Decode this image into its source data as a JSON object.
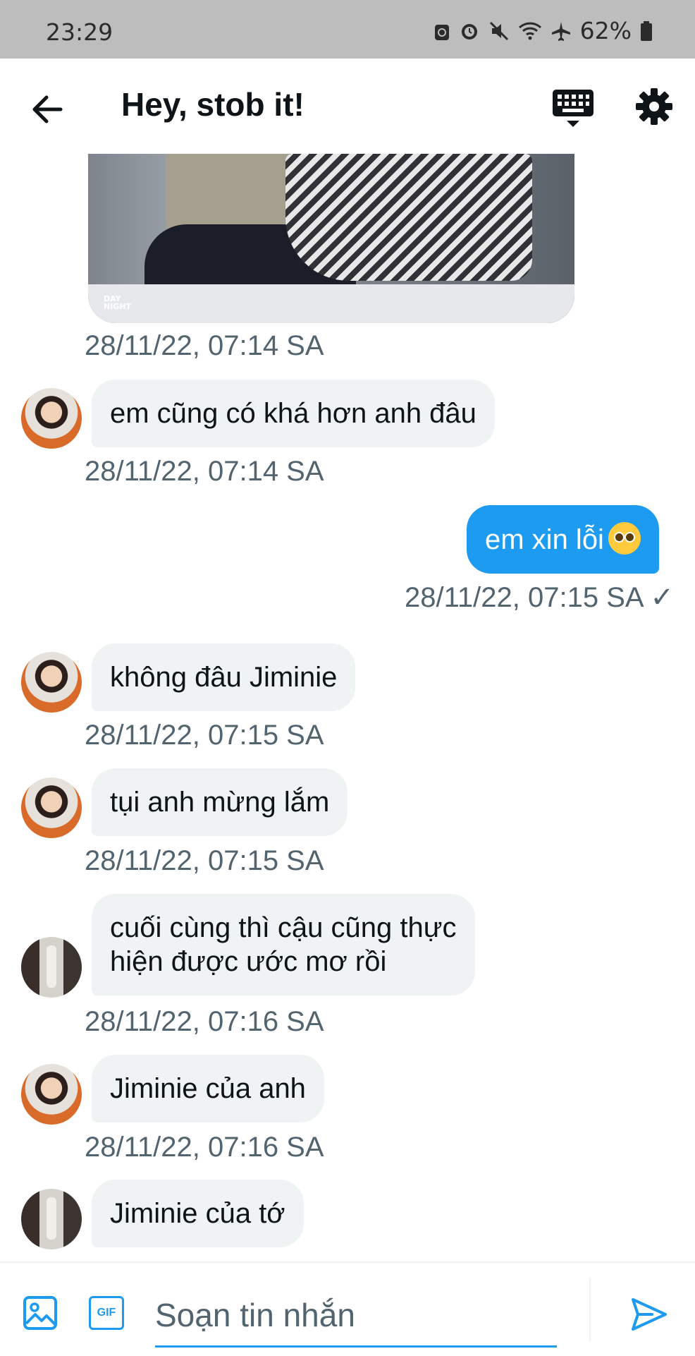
{
  "status_bar": {
    "time": "23:29",
    "battery": "62%"
  },
  "header": {
    "title": "Hey, stob it!"
  },
  "photo": {
    "logo_line1": "DAY",
    "logo_line2": "NIGHT"
  },
  "messages": [
    {
      "timestamp": "28/11/22, 07:14 SA"
    },
    {
      "text": "em cũng có khá hơn anh đâu",
      "timestamp": "28/11/22, 07:14 SA"
    },
    {
      "text": "em xin lỗi",
      "timestamp": "28/11/22, 07:15 SA ✓"
    },
    {
      "text": "không đâu Jiminie",
      "timestamp": "28/11/22, 07:15 SA"
    },
    {
      "text": "tụi anh mừng lắm",
      "timestamp": "28/11/22, 07:15 SA"
    },
    {
      "text_line1": "cuối cùng thì cậu cũng thực",
      "text_line2": "hiện được ước mơ rồi",
      "timestamp": "28/11/22, 07:16 SA"
    },
    {
      "text": "Jiminie của anh",
      "timestamp": "28/11/22, 07:16 SA"
    },
    {
      "text": "Jiminie của tớ"
    }
  ],
  "composer": {
    "placeholder": "Soạn tin nhắn",
    "gif_label": "GIF"
  },
  "icons": {
    "back": "arrow-left-icon",
    "keyboard": "keyboard-icon",
    "settings": "gear-icon",
    "image": "image-icon",
    "gif": "gif-icon",
    "send": "send-icon"
  },
  "colors": {
    "accent": "#1d9bf0",
    "bubble_in": "#eff3f4",
    "timestamp": "#536471"
  }
}
